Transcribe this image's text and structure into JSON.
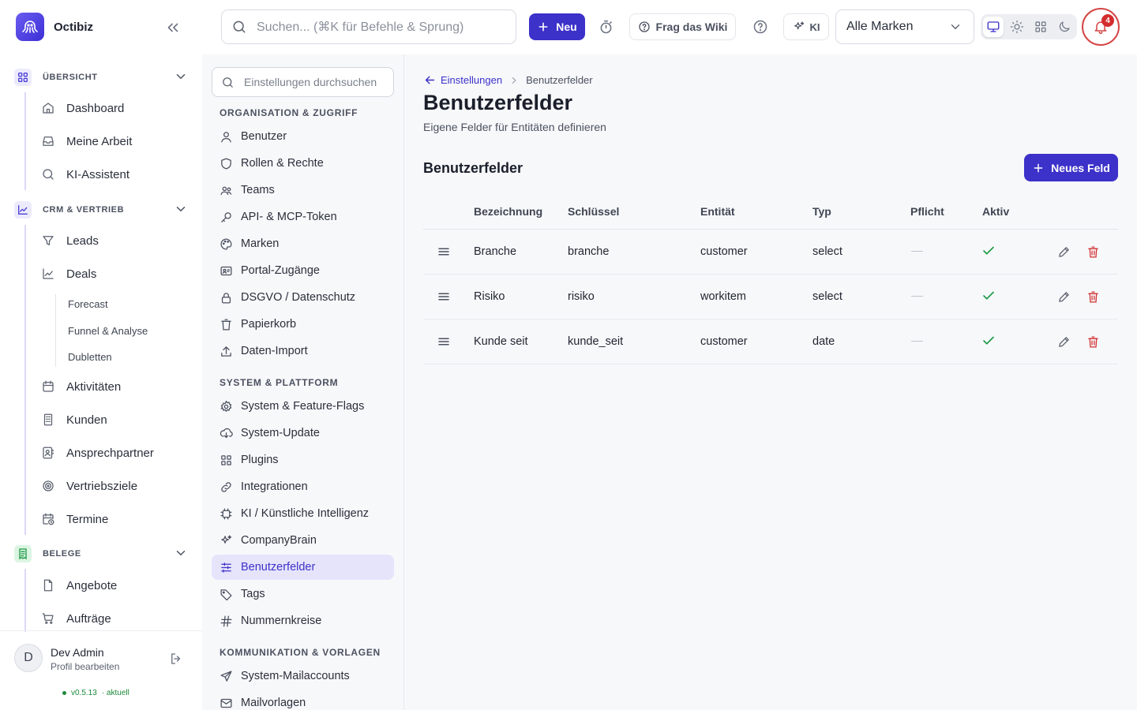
{
  "app": {
    "name": "Octibiz"
  },
  "topbar": {
    "search_placeholder": "Suchen... (⌘K für Befehle & Sprung)",
    "new_label": "Neu",
    "wiki_label": "Frag das Wiki",
    "ki_label": "KI",
    "brand_select": "Alle Marken",
    "notifications_count": "4",
    "accent_color": "#3c31c9"
  },
  "nav": {
    "sections": [
      {
        "label": "ÜBERSICHT",
        "items": [
          "Dashboard",
          "Meine Arbeit",
          "KI-Assistent"
        ]
      },
      {
        "label": "CRM & VERTRIEB",
        "items": [
          "Leads",
          "Deals",
          "Aktivitäten",
          "Kunden",
          "Ansprechpartner",
          "Vertriebsziele",
          "Termine"
        ],
        "subitems": [
          "Forecast",
          "Funnel & Analyse",
          "Dubletten"
        ]
      },
      {
        "label": "BELEGE",
        "items": [
          "Angebote",
          "Aufträge"
        ]
      }
    ],
    "user": {
      "name": "Dev Admin",
      "subtitle": "Profil bearbeiten",
      "initial": "D",
      "version": "v0.5.13",
      "version_status": "· aktuell"
    }
  },
  "settings_nav": {
    "search_placeholder": "Einstellungen durchsuchen",
    "groups": [
      {
        "label": "ORGANISATION & ZUGRIFF",
        "items": [
          "Benutzer",
          "Rollen & Rechte",
          "Teams",
          "API- & MCP-Token",
          "Marken",
          "Portal-Zugänge",
          "DSGVO / Datenschutz",
          "Papierkorb",
          "Daten-Import"
        ]
      },
      {
        "label": "SYSTEM & PLATTFORM",
        "items": [
          "System & Feature-Flags",
          "System-Update",
          "Plugins",
          "Integrationen",
          "KI / Künstliche Intelligenz",
          "CompanyBrain",
          "Benutzerfelder",
          "Tags",
          "Nummernkreise"
        ]
      },
      {
        "label": "KOMMUNIKATION & VORLAGEN",
        "items": [
          "System-Mailaccounts",
          "Mailvorlagen"
        ]
      }
    ],
    "active": "Benutzerfelder"
  },
  "main": {
    "breadcrumb": {
      "back": "Einstellungen",
      "current": "Benutzerfelder"
    },
    "title": "Benutzerfelder",
    "subtitle": "Eigene Felder für Entitäten definieren",
    "section_title": "Benutzerfelder",
    "new_field_label": "Neues Feld",
    "table": {
      "columns": [
        "Bezeichnung",
        "Schlüssel",
        "Entität",
        "Typ",
        "Pflicht",
        "Aktiv"
      ],
      "rows": [
        {
          "label": "Branche",
          "key": "branche",
          "entity": "customer",
          "type": "select",
          "required": false,
          "active": true
        },
        {
          "label": "Risiko",
          "key": "risiko",
          "entity": "workitem",
          "type": "select",
          "required": false,
          "active": true
        },
        {
          "label": "Kunde seit",
          "key": "kunde_seit",
          "entity": "customer",
          "type": "date",
          "required": false,
          "active": true
        }
      ]
    }
  }
}
